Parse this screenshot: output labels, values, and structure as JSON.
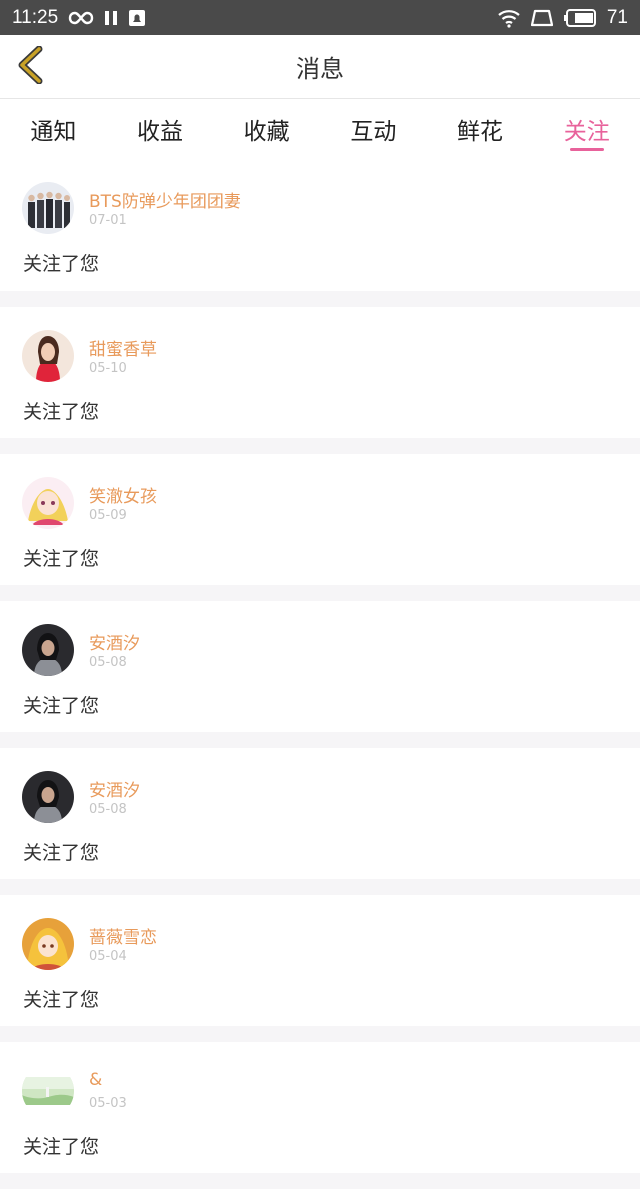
{
  "status_bar": {
    "time": "11:25",
    "battery": "71",
    "icons": [
      "infinity-icon",
      "pause-icon",
      "notification-icon",
      "wifi-icon",
      "screen-icon",
      "battery-icon"
    ]
  },
  "header": {
    "title": "消息",
    "back_icon": "chevron-left-icon"
  },
  "tabs": [
    {
      "label": "通知",
      "active": false
    },
    {
      "label": "收益",
      "active": false
    },
    {
      "label": "收藏",
      "active": false
    },
    {
      "label": "互动",
      "active": false
    },
    {
      "label": "鲜花",
      "active": false
    },
    {
      "label": "关注",
      "active": true
    }
  ],
  "colors": {
    "accent": "#e8629b",
    "name": "#e89a5b",
    "back_icon": "#c9a227"
  },
  "messages": [
    {
      "name": "BTS防弹少年团团妻",
      "date": "07-01",
      "text": "关注了您"
    },
    {
      "name": "甜蜜香草",
      "date": "05-10",
      "text": "关注了您"
    },
    {
      "name": "笑澈女孩",
      "date": "05-09",
      "text": "关注了您"
    },
    {
      "name": "安酒汐",
      "date": "05-08",
      "text": "关注了您"
    },
    {
      "name": "安酒汐",
      "date": "05-08",
      "text": "关注了您"
    },
    {
      "name": "蔷薇雪恋",
      "date": "05-04",
      "text": "关注了您"
    },
    {
      "name": "&",
      "date": "05-03",
      "text": "关注了您"
    }
  ]
}
